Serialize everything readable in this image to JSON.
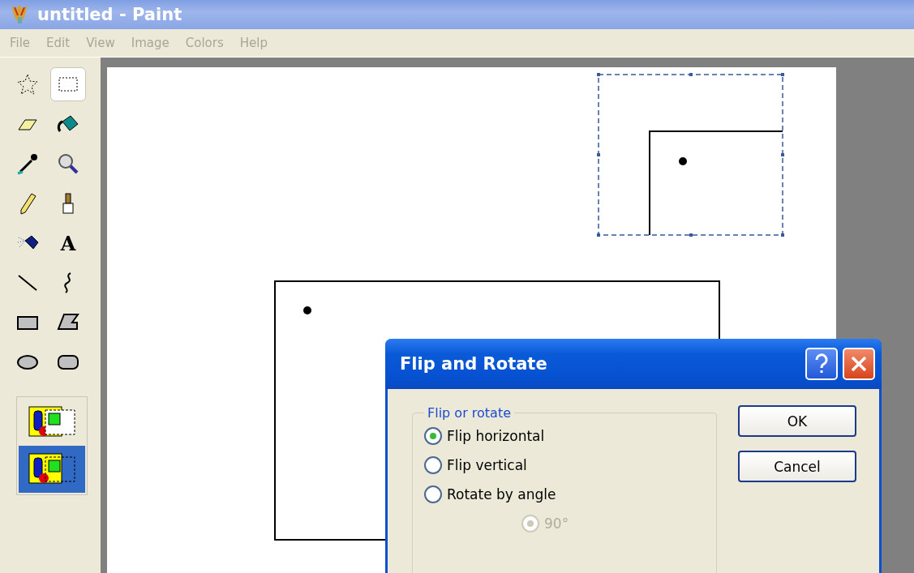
{
  "window": {
    "title": "untitled - Paint"
  },
  "menu": [
    "File",
    "Edit",
    "View",
    "Image",
    "Colors",
    "Help"
  ],
  "tools": [
    {
      "kind": "free-select",
      "selected": false
    },
    {
      "kind": "rect-select",
      "selected": true
    },
    {
      "kind": "eraser",
      "selected": false
    },
    {
      "kind": "fill",
      "selected": false
    },
    {
      "kind": "picker",
      "selected": false
    },
    {
      "kind": "magnifier",
      "selected": false
    },
    {
      "kind": "pencil",
      "selected": false
    },
    {
      "kind": "brush",
      "selected": false
    },
    {
      "kind": "airbrush",
      "selected": false
    },
    {
      "kind": "text",
      "glyph": "A",
      "selected": false
    },
    {
      "kind": "line",
      "selected": false
    },
    {
      "kind": "curve",
      "selected": false
    },
    {
      "kind": "rectangle",
      "selected": false
    },
    {
      "kind": "polygon",
      "selected": false
    },
    {
      "kind": "ellipse",
      "selected": false
    },
    {
      "kind": "rounded-rectangle",
      "selected": false
    }
  ],
  "tool_options": [
    {
      "kind": "opaque",
      "selected": false
    },
    {
      "kind": "transparent",
      "selected": true
    }
  ],
  "dialog": {
    "title": "Flip and Rotate",
    "group_label": "Flip or rotate",
    "options": [
      {
        "label": "Flip horizontal",
        "selected": true
      },
      {
        "label": "Flip vertical",
        "selected": false
      },
      {
        "label": "Rotate by angle",
        "selected": false
      }
    ],
    "angle_options": [
      {
        "label": "90°",
        "selected": true,
        "disabled": true
      }
    ],
    "buttons": [
      "OK",
      "Cancel"
    ]
  }
}
